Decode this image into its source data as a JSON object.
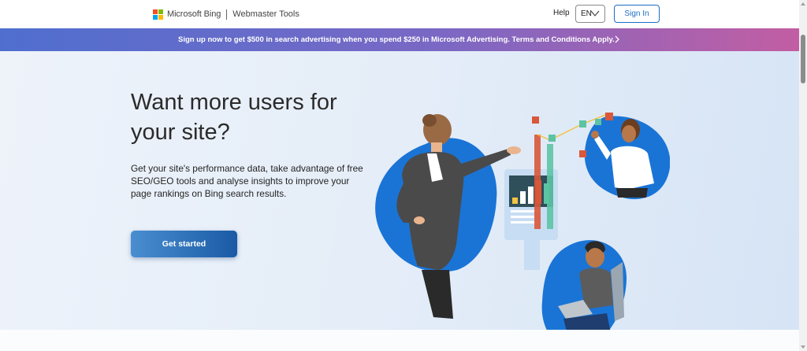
{
  "header": {
    "brand": "Microsoft Bing",
    "product": "Webmaster Tools",
    "help_label": "Help",
    "language": "EN",
    "signin_label": "Sign In"
  },
  "promo": {
    "text": "Sign up now to get $500 in search advertising when you spend $250 in Microsoft Advertising.   Terms and Conditions Apply."
  },
  "hero": {
    "title": "Want more users for your site?",
    "subtitle": "Get your site's performance data, take advantage of free SEO/GEO tools and analyse insights to improve your page rankings on Bing search results.",
    "cta_label": "Get started"
  },
  "colors": {
    "accent": "#1a6fc7",
    "logo_red": "#f25022",
    "logo_green": "#7fba00",
    "logo_blue": "#00a4ef",
    "logo_yellow": "#ffb900",
    "blob_blue": "#1a74d6"
  },
  "icons": [
    "chevron-down-icon",
    "chevron-right-icon",
    "microsoft-logo-icon"
  ]
}
